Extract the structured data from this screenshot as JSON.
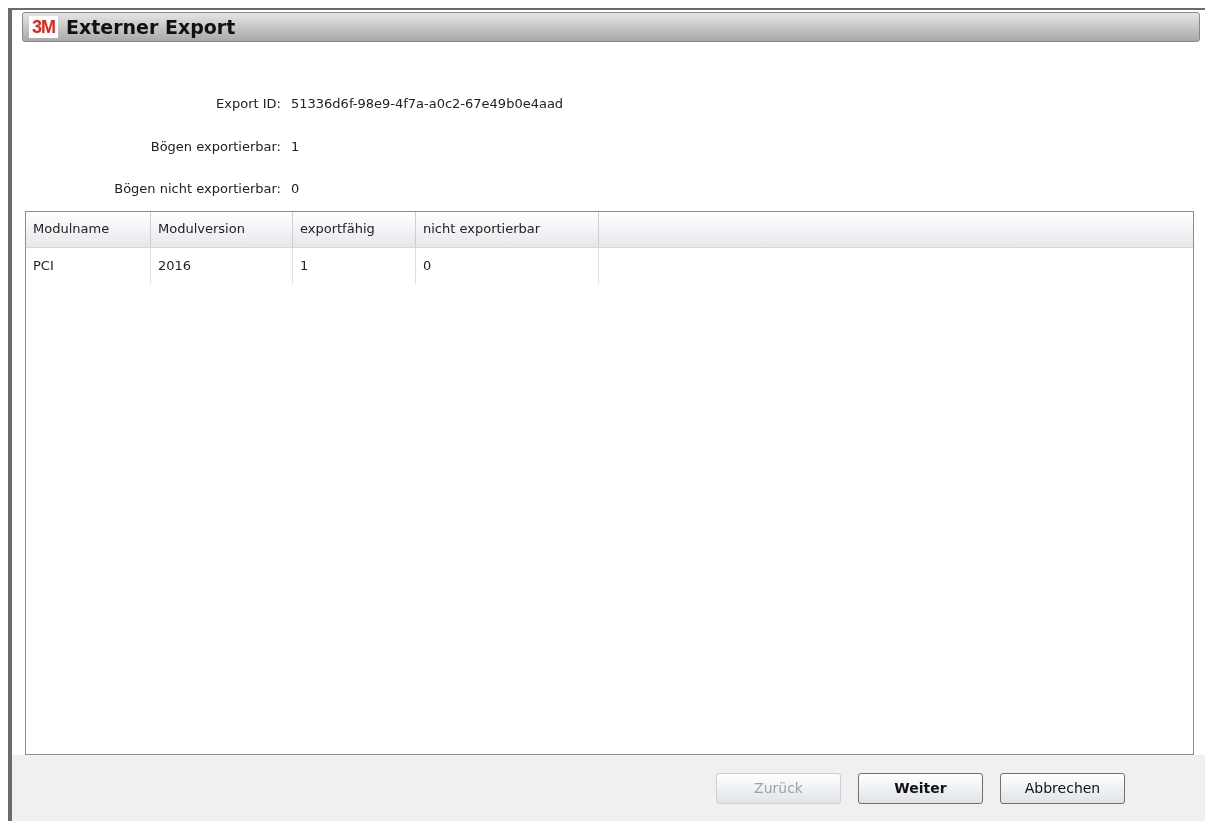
{
  "window": {
    "logo": "3M",
    "title": "Externer Export"
  },
  "fields": [
    {
      "label": "Export ID:",
      "value": "51336d6f-98e9-4f7a-a0c2-67e49b0e4aad"
    },
    {
      "label": "Bögen exportierbar:",
      "value": "1"
    },
    {
      "label": "Bögen nicht exportierbar:",
      "value": "0"
    }
  ],
  "table": {
    "columns": [
      "Modulname",
      "Modulversion",
      "exportfähig",
      "nicht exportierbar"
    ],
    "rows": [
      [
        "PCI",
        "2016",
        "1",
        "0"
      ]
    ]
  },
  "buttons": [
    {
      "label": "Zurück",
      "disabled": true,
      "default": false
    },
    {
      "label": "Weiter",
      "disabled": false,
      "default": true
    },
    {
      "label": "Abbrechen",
      "disabled": false,
      "default": false
    }
  ]
}
